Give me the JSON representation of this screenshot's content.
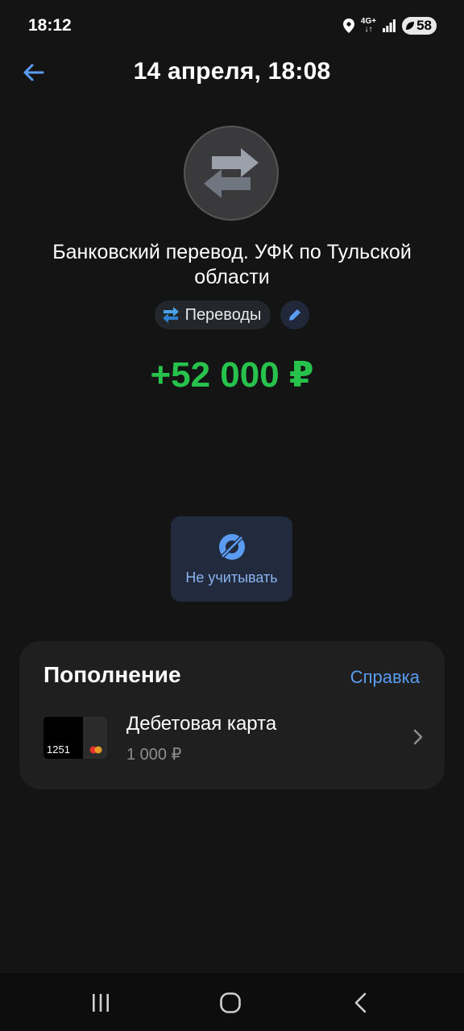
{
  "status_bar": {
    "time": "18:12",
    "network": "4G+",
    "battery": "58"
  },
  "header": {
    "title": "14 апреля, 18:08"
  },
  "transaction": {
    "merchant": "Банковский перевод. УФК по Тульской области",
    "category": "Переводы",
    "amount": "+52 000 ₽"
  },
  "actions": {
    "ignore_label": "Не учитывать"
  },
  "top_up": {
    "title": "Пополнение",
    "help_link": "Справка",
    "account": {
      "card_last_digits": "1251",
      "name": "Дебетовая карта",
      "balance": "1 000 ₽"
    }
  },
  "colors": {
    "background": "#141414",
    "accent": "#5a9cf2",
    "amount_positive": "#27c24c"
  }
}
